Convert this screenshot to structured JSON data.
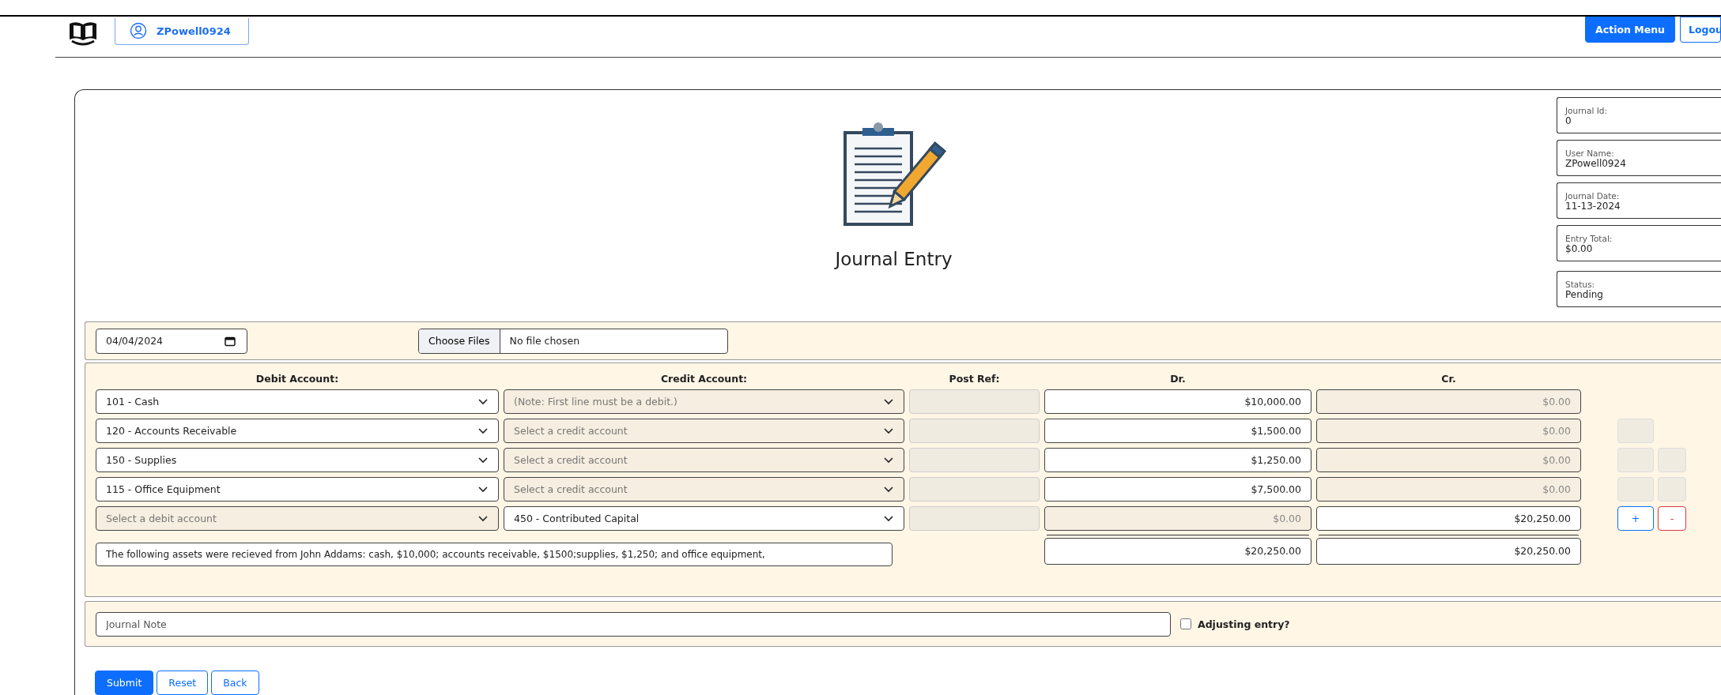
{
  "nav": {
    "user": "ZPowell0924",
    "buttons": [
      {
        "kind": "primary",
        "label": "Action Menu"
      },
      {
        "kind": "outline",
        "label": "Logou"
      }
    ]
  },
  "header": {
    "title": "Journal Entry",
    "info": [
      {
        "label": "Journal Id:",
        "value": "0"
      },
      {
        "label": "User Name:",
        "value": "ZPowell0924"
      },
      {
        "label": "Journal Date:",
        "value": "11-13-2024"
      },
      {
        "label": "Entry Total:",
        "value": "$0.00"
      },
      {
        "label": "Status:",
        "value": "Pending"
      }
    ]
  },
  "date": "04/04/2024",
  "file": {
    "button": "Choose Files",
    "status": "No file chosen"
  },
  "columns": [
    "Debit Account:",
    "Credit Account:",
    "Post Ref:",
    "Dr.",
    "Cr."
  ],
  "lines": [
    {
      "debit": {
        "value": "101 - Cash",
        "disabled": false
      },
      "credit": {
        "placeholder": "(Note: First line must be a debit.)",
        "disabled": true
      },
      "dr": {
        "value": "$10,000.00",
        "disabled": false
      },
      "cr": {
        "value": "$0.00",
        "disabled": true
      }
    },
    {
      "debit": {
        "value": "120 - Accounts Receivable",
        "disabled": false
      },
      "credit": {
        "placeholder": "Select a credit account",
        "disabled": true
      },
      "dr": {
        "value": "$1,500.00",
        "disabled": false
      },
      "cr": {
        "value": "$0.00",
        "disabled": true
      },
      "buttons": [
        {
          "kind": "add",
          "disabled": true
        }
      ]
    },
    {
      "debit": {
        "value": "150 - Supplies",
        "disabled": false
      },
      "credit": {
        "placeholder": "Select a credit account",
        "disabled": true
      },
      "dr": {
        "value": "$1,250.00",
        "disabled": false
      },
      "cr": {
        "value": "$0.00",
        "disabled": true
      },
      "buttons": [
        {
          "kind": "add",
          "disabled": true
        },
        {
          "kind": "remove",
          "disabled": true
        }
      ]
    },
    {
      "debit": {
        "value": "115 - Office Equipment",
        "disabled": false
      },
      "credit": {
        "placeholder": "Select a credit account",
        "disabled": true
      },
      "dr": {
        "value": "$7,500.00",
        "disabled": false
      },
      "cr": {
        "value": "$0.00",
        "disabled": true
      },
      "buttons": [
        {
          "kind": "add",
          "disabled": true
        },
        {
          "kind": "remove",
          "disabled": true
        }
      ]
    },
    {
      "debit": {
        "placeholder": "Select a debit account",
        "disabled": true
      },
      "credit": {
        "value": "450 - Contributed Capital",
        "disabled": false
      },
      "dr": {
        "value": "$0.00",
        "disabled": true
      },
      "cr": {
        "value": "$20,250.00",
        "disabled": false
      },
      "buttons": [
        {
          "kind": "add",
          "label": "+",
          "disabled": false
        },
        {
          "kind": "remove",
          "label": "-",
          "disabled": false
        }
      ]
    }
  ],
  "description": "The following assets were recieved from John Addams: cash, $10,000; accounts receivable, $1500;supplies, $1,250; and office equipment,",
  "totals": {
    "dr": "$20,250.00",
    "cr": "$20,250.00"
  },
  "note": {
    "placeholder": "Journal Note"
  },
  "adjusting": {
    "label": "Adjusting entry?",
    "checked": false
  },
  "actions": [
    {
      "kind": "primary",
      "label": "Submit"
    },
    {
      "kind": "outline",
      "label": "Reset"
    },
    {
      "kind": "outline",
      "label": "Back"
    }
  ]
}
